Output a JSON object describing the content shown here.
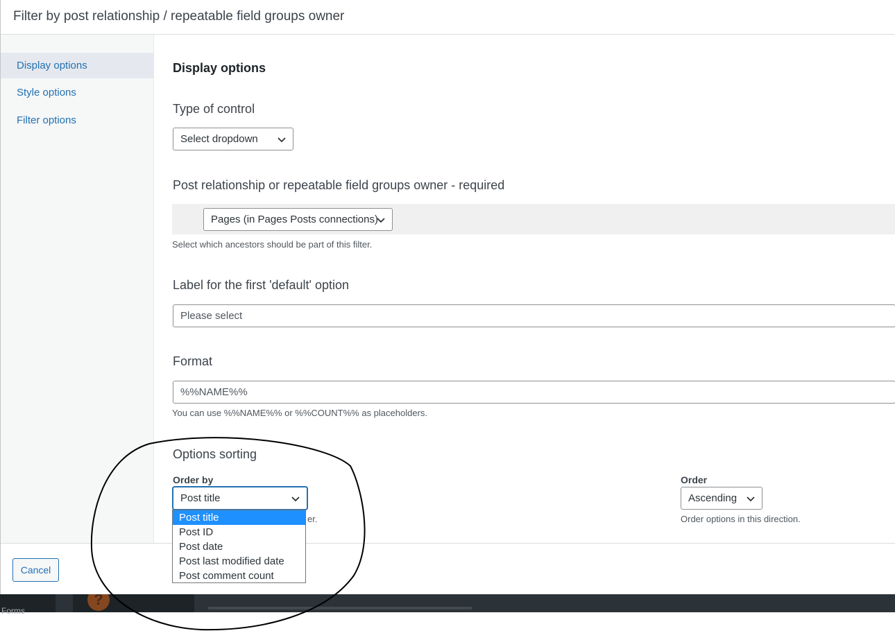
{
  "modal": {
    "title": "Filter by post relationship / repeatable field groups owner"
  },
  "sidebar": {
    "items": [
      {
        "label": "Display options"
      },
      {
        "label": "Style options"
      },
      {
        "label": "Filter options"
      }
    ]
  },
  "content": {
    "section_title": "Display options",
    "type_of_control": {
      "label": "Type of control",
      "value": "Select dropdown"
    },
    "relationship": {
      "label": "Post relationship or repeatable field groups owner - required",
      "value": "Pages (in Pages Posts connections)",
      "help": "Select which ancestors should be part of this filter."
    },
    "default_label": {
      "label": "Label for the first 'default' option",
      "value": "Please select"
    },
    "format": {
      "label": "Format",
      "value": "%%NAME%%",
      "help": "You can use %%NAME%% or %%COUNT%% as placeholders."
    },
    "sorting": {
      "label": "Options sorting",
      "order_by_label": "Order by",
      "order_by_value": "Post title",
      "order_by_help_tail": "er.",
      "order_label": "Order",
      "order_value": "Ascending",
      "order_help": "Order options in this direction.",
      "options": [
        "Post title",
        "Post ID",
        "Post date",
        "Post last modified date",
        "Post comment count"
      ]
    }
  },
  "footer": {
    "cancel_label": "Cancel"
  },
  "background": {
    "sidebar_fragment": "Forms"
  },
  "colors": {
    "accent": "#2271b1",
    "highlight": "#1e90ff"
  }
}
